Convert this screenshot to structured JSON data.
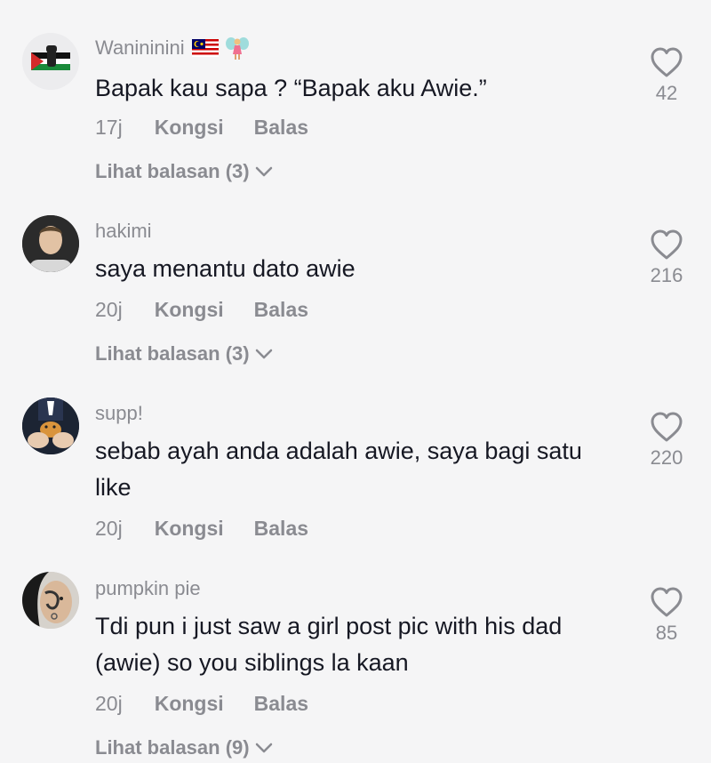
{
  "comments": [
    {
      "username": "Wanininini",
      "emojis": [
        "malaysia-flag-icon",
        "fairy-icon"
      ],
      "text": "Bapak kau sapa ? “Bapak aku Awie.”",
      "time": "17j",
      "share": "Kongsi",
      "reply": "Balas",
      "view_replies": "Lihat balasan (3)",
      "likes": "42",
      "avatar": "palestine-flag-fist-avatar"
    },
    {
      "username": "hakimi",
      "text": "saya menantu dato awie",
      "time": "20j",
      "share": "Kongsi",
      "reply": "Balas",
      "view_replies": "Lihat balasan (3)",
      "likes": "216",
      "avatar": "person-photo-avatar"
    },
    {
      "username": "supp!",
      "text": "sebab ayah anda adalah awie, saya bagi satu like",
      "time": "20j",
      "share": "Kongsi",
      "reply": "Balas",
      "likes": "220",
      "avatar": "hands-holding-pet-avatar"
    },
    {
      "username": "pumpkin pie",
      "text": "Tdi pun i just saw a girl post pic with his dad (awie) so you siblings la kaan",
      "time": "20j",
      "share": "Kongsi",
      "reply": "Balas",
      "view_replies": "Lihat balasan (9)",
      "likes": "85",
      "avatar": "tattooed-face-avatar"
    }
  ],
  "colors": {
    "background": "#f5f5f6",
    "primary_text": "#161823",
    "secondary_text": "#8a8b91"
  }
}
